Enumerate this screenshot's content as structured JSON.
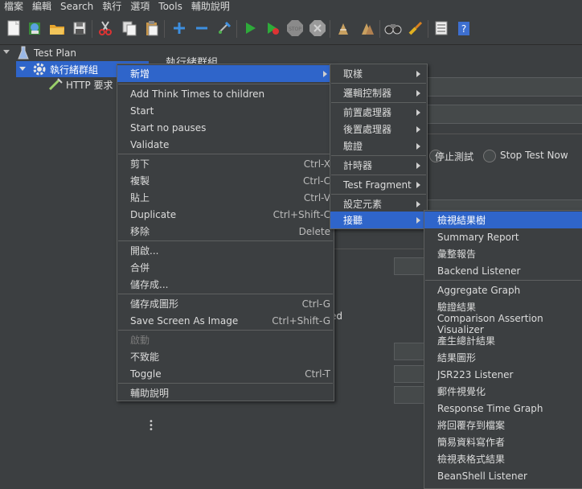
{
  "menubar": [
    "檔案",
    "編輯",
    "Search",
    "執行",
    "選項",
    "Tools",
    "輔助說明"
  ],
  "tree": {
    "test_plan": "Test Plan",
    "thread_group": "執行緒群組",
    "http_request": "HTTP 要求"
  },
  "main": {
    "title": "執行緒群組",
    "stop_test": "停止測試",
    "stop_test_now": "Stop Test Now",
    "partial_text": "ed"
  },
  "context_menu": {
    "add": "新增",
    "add_think_times": "Add Think Times to children",
    "start": "Start",
    "start_no_pauses": "Start no pauses",
    "validate": "Validate",
    "cut": "剪下",
    "cut_sc": "Ctrl-X",
    "copy": "複製",
    "copy_sc": "Ctrl-C",
    "paste": "貼上",
    "paste_sc": "Ctrl-V",
    "duplicate": "Duplicate",
    "duplicate_sc": "Ctrl+Shift-C",
    "remove": "移除",
    "remove_sc": "Delete",
    "open": "開啟...",
    "merge": "合併",
    "save_as": "儲存成...",
    "save_as_image": "儲存成圖形",
    "save_as_image_sc": "Ctrl-G",
    "save_screen": "Save Screen As Image",
    "save_screen_sc": "Ctrl+Shift-G",
    "enable": "啟動",
    "disable": "不致能",
    "toggle": "Toggle",
    "toggle_sc": "Ctrl-T",
    "help": "輔助說明"
  },
  "add_submenu": {
    "sampler": "取樣",
    "logic_controller": "邏輯控制器",
    "pre_processor": "前置處理器",
    "post_processor": "後置處理器",
    "assertions": "驗證",
    "timer": "計時器",
    "test_fragment": "Test Fragment",
    "config_element": "設定元素",
    "listener": "接聽"
  },
  "listener_submenu": [
    "檢視結果樹",
    "Summary Report",
    "彙整報告",
    "Backend Listener",
    "Aggregate Graph",
    "驗證結果",
    "Comparison Assertion Visualizer",
    "產生總計結果",
    "結果圖形",
    "JSR223 Listener",
    "郵件視覺化",
    "Response Time Graph",
    "將回覆存到檔案",
    "簡易資料寫作者",
    "檢視表格式結果",
    "BeanShell Listener"
  ]
}
